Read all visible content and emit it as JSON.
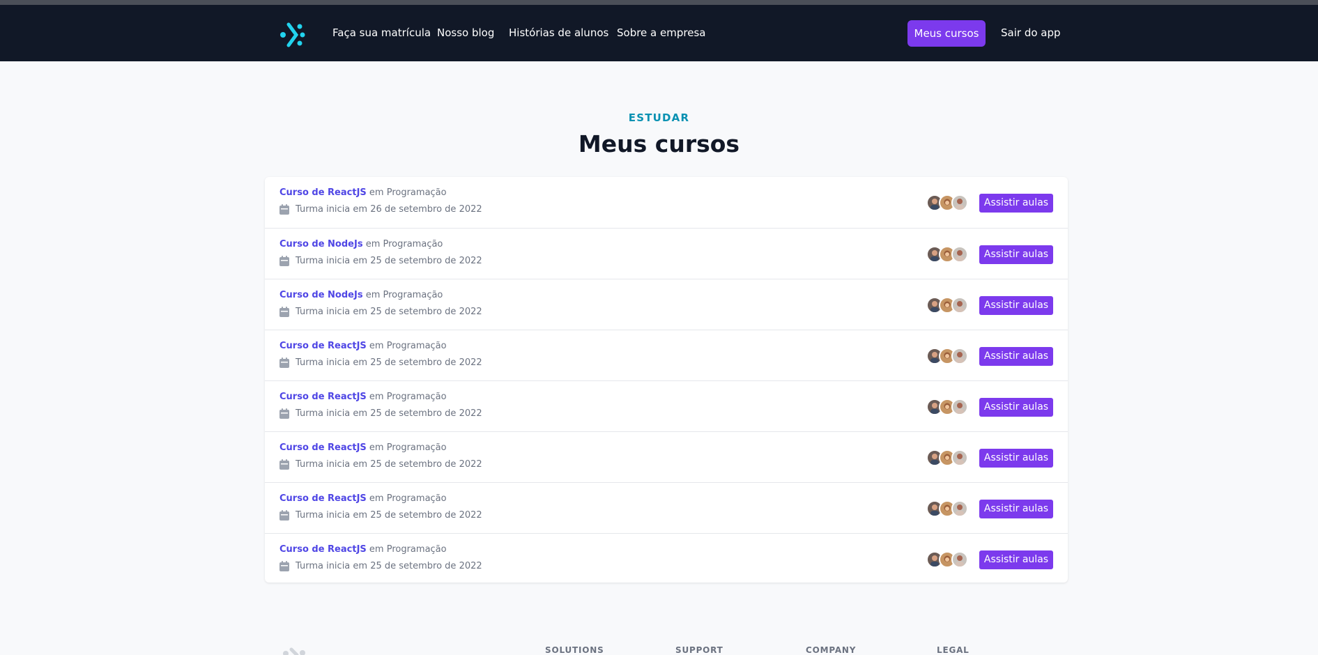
{
  "nav": {
    "links": [
      "Faça sua matrícula",
      "Nosso blog",
      "Histórias de alunos",
      "Sobre a empresa"
    ],
    "primary_button": "Meus cursos",
    "signout": "Sair do app"
  },
  "header": {
    "eyebrow": "ESTUDAR",
    "title": "Meus cursos"
  },
  "courses": [
    {
      "name": "Curso de ReactJS",
      "category": "em Programação",
      "date": "Turma inicia em 26 de setembro de 2022",
      "action": "Assistir aulas"
    },
    {
      "name": "Curso de NodeJs",
      "category": "em Programação",
      "date": "Turma inicia em 25 de setembro de 2022",
      "action": "Assistir aulas"
    },
    {
      "name": "Curso de NodeJs",
      "category": "em Programação",
      "date": "Turma inicia em 25 de setembro de 2022",
      "action": "Assistir aulas"
    },
    {
      "name": "Curso de ReactJS",
      "category": "em Programação",
      "date": "Turma inicia em 25 de setembro de 2022",
      "action": "Assistir aulas"
    },
    {
      "name": "Curso de ReactJS",
      "category": "em Programação",
      "date": "Turma inicia em 25 de setembro de 2022",
      "action": "Assistir aulas"
    },
    {
      "name": "Curso de ReactJS",
      "category": "em Programação",
      "date": "Turma inicia em 25 de setembro de 2022",
      "action": "Assistir aulas"
    },
    {
      "name": "Curso de ReactJS",
      "category": "em Programação",
      "date": "Turma inicia em 25 de setembro de 2022",
      "action": "Assistir aulas"
    },
    {
      "name": "Curso de ReactJS",
      "category": "em Programação",
      "date": "Turma inicia em 25 de setembro de 2022",
      "action": "Assistir aulas"
    }
  ],
  "footer": {
    "headings": [
      "SOLUTIONS",
      "SUPPORT",
      "COMPANY",
      "LEGAL"
    ]
  },
  "colors": {
    "nav_bg": "#111827",
    "accent": "#7c3aed",
    "link": "#4f46e5",
    "eyebrow": "#0891b2",
    "logo": "#22d3ee"
  },
  "icons": {
    "logo": "brand-logo-icon",
    "date": "calendar-icon",
    "avatars": "avatar-group"
  }
}
